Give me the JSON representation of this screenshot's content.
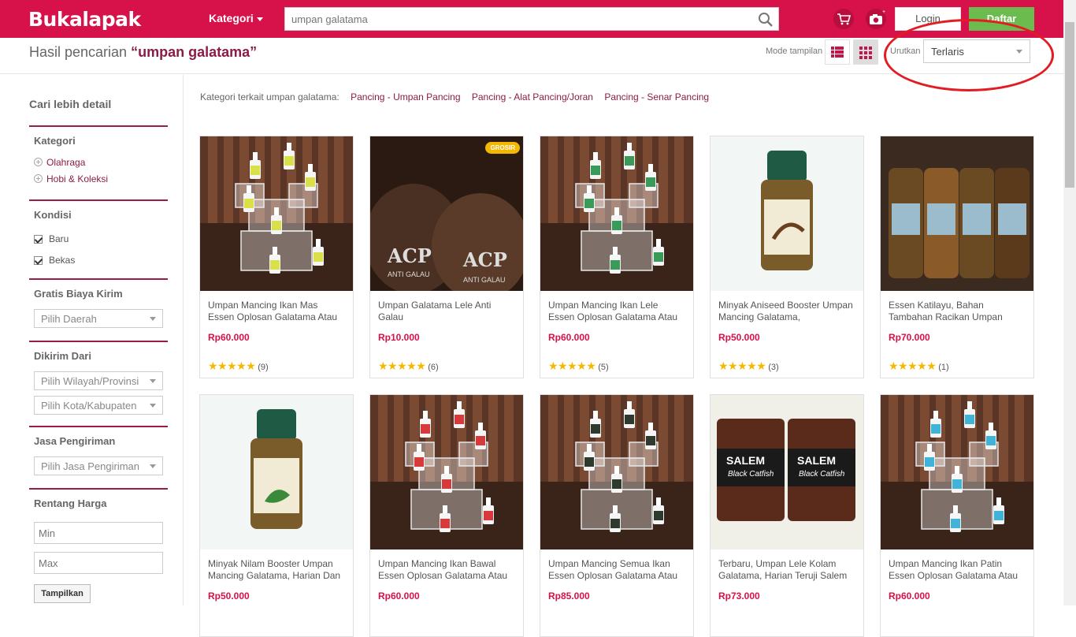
{
  "brand": "Bukalapak",
  "header": {
    "kategori_label": "Kategori",
    "search_placeholder": "umpan galatama",
    "login_label": "Login",
    "daftar_label": "Daftar"
  },
  "results": {
    "prefix": "Hasil pencarian",
    "query": "“umpan galatama”",
    "mode_label": "Mode tampilan",
    "sort_label": "Urutkan",
    "sort_value": "Terlaris"
  },
  "sidebar": {
    "title": "Cari lebih detail",
    "kategori": {
      "heading": "Kategori",
      "items": [
        "Olahraga",
        "Hobi & Koleksi"
      ]
    },
    "kondisi": {
      "heading": "Kondisi",
      "items": [
        "Baru",
        "Bekas"
      ]
    },
    "gratis": {
      "heading": "Gratis Biaya Kirim",
      "select": "Pilih Daerah"
    },
    "dikirim": {
      "heading": "Dikirim Dari",
      "select1": "Pilih Wilayah/Provinsi",
      "select2": "Pilih Kota/Kabupaten"
    },
    "jasa": {
      "heading": "Jasa Pengiriman",
      "select": "Pilih Jasa Pengiriman"
    },
    "harga": {
      "heading": "Rentang Harga",
      "min": "Min",
      "max": "Max",
      "button": "Tampilkan"
    }
  },
  "related": {
    "label": "Kategori terkait umpan galatama:",
    "links": [
      "Pancing - Umpan Pancing",
      "Pancing - Alat Pancing/Joran",
      "Pancing - Senar Pancing"
    ]
  },
  "products": [
    {
      "name": "Umpan Mancing Ikan Mas Essen Oplosan Galatama Atau",
      "price": "Rp60.000",
      "stars": "★★★★★",
      "reviews": "(9)",
      "img": "bottles-yellow"
    },
    {
      "name": "Umpan Galatama Lele Anti Galau",
      "price": "Rp10.000",
      "stars": "★★★★★",
      "reviews": "(6)",
      "img": "bags-acp",
      "badge": "GROSIR"
    },
    {
      "name": "Umpan Mancing Ikan Lele Essen Oplosan Galatama Atau",
      "price": "Rp60.000",
      "stars": "★★★★★",
      "reviews": "(5)",
      "img": "bottles-green"
    },
    {
      "name": "Minyak Aniseed Booster Umpan Mancing Galatama,",
      "price": "Rp50.000",
      "stars": "★★★★★",
      "reviews": "(3)",
      "img": "oil-anise"
    },
    {
      "name": "Essen Katilayu, Bahan Tambahan Racikan Umpan",
      "price": "Rp70.000",
      "stars": "★★★★★",
      "reviews": "(1)",
      "img": "essence-bottles"
    },
    {
      "name": "Minyak Nilam Booster Umpan Mancing Galatama, Harian Dan",
      "price": "Rp50.000",
      "img": "oil-nilam"
    },
    {
      "name": "Umpan Mancing Ikan Bawal Essen Oplosan Galatama Atau",
      "price": "Rp60.000",
      "img": "bottles-red"
    },
    {
      "name": "Umpan Mancing Semua Ikan Essen Oplosan Galatama Atau",
      "price": "Rp85.000",
      "img": "bottles-dark"
    },
    {
      "name": "Terbaru, Umpan Lele Kolam Galatama, Harian Teruji Salem",
      "price": "Rp73.000",
      "img": "salem-jars"
    },
    {
      "name": "Umpan Mancing Ikan Patin Essen Oplosan Galatama Atau",
      "price": "Rp60.000",
      "img": "bottles-blue"
    }
  ],
  "colors": {
    "brand": "#d71149",
    "accent": "#8b1c47",
    "success": "#6bbb4e",
    "star": "#f5b800",
    "annotation": "#e31b23"
  }
}
